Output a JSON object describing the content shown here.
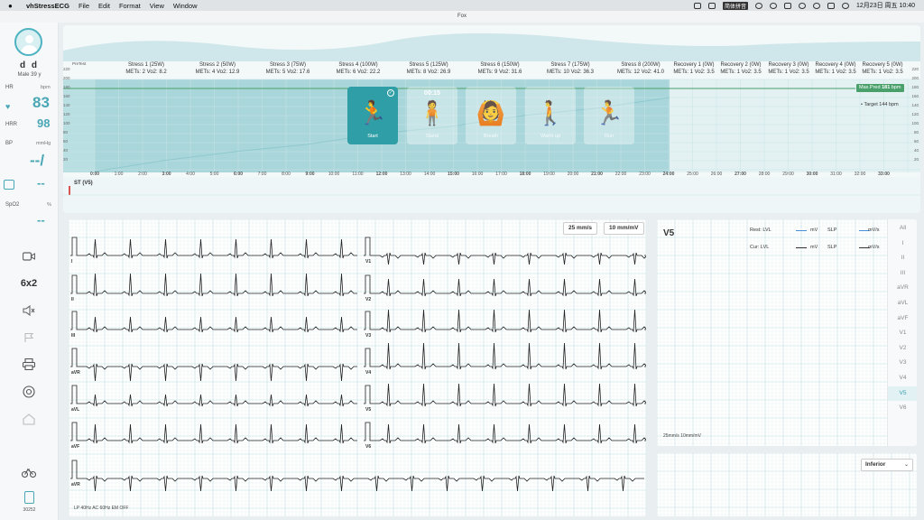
{
  "menubar": {
    "apple": "",
    "app": "vhStressECG",
    "menus": [
      "File",
      "Edit",
      "Format",
      "View",
      "Window"
    ],
    "ime": "简体拼音",
    "datetime": "12月23日 周五  10:40"
  },
  "window": {
    "title": "Fox"
  },
  "patient": {
    "name": "d d",
    "info": "Male 39 y"
  },
  "vitals": {
    "hr_label": "HR",
    "hr_unit": "bpm",
    "hr_value": "83",
    "hrr_label": "HRR",
    "hrr_value": "98",
    "bp_label": "BP",
    "bp_unit": "mmHg",
    "bp_value": "--/",
    "resp_value": "--",
    "spo2_label": "SpO2",
    "spo2_unit": "%",
    "spo2_value": "--"
  },
  "sidebar": {
    "layout_label": "6x2",
    "device_id": "30252",
    "icons": [
      "video-icon",
      "mute-icon",
      "flag-icon",
      "print-icon",
      "stop-icon",
      "home-icon",
      "bike-icon",
      "battery-icon"
    ]
  },
  "trend": {
    "pretest": "PreTest",
    "y_ticks": [
      "220",
      "200",
      "180",
      "160",
      "140",
      "120",
      "100",
      "80",
      "60",
      "40",
      "20"
    ],
    "stages": [
      {
        "name": "Stress 1 (25W)",
        "mets": "METs: 2  Vo2: 8.2"
      },
      {
        "name": "Stress 2 (50W)",
        "mets": "METs: 4  Vo2: 12.9"
      },
      {
        "name": "Stress 3 (75W)",
        "mets": "METs: 5  Vo2: 17.6"
      },
      {
        "name": "Stress 4 (100W)",
        "mets": "METs: 6  Vo2: 22.2"
      },
      {
        "name": "Stress 5 (125W)",
        "mets": "METs: 8  Vo2: 26.9"
      },
      {
        "name": "Stress 6 (150W)",
        "mets": "METs: 9  Vo2: 31.6"
      },
      {
        "name": "Stress 7 (175W)",
        "mets": "METs: 10  Vo2: 36.3"
      },
      {
        "name": "Stress 8 (200W)",
        "mets": "METs: 12  Vo2: 41.0"
      },
      {
        "name": "Recovery 1 (0W)",
        "mets": "METs: 1  Vo2: 3.5"
      },
      {
        "name": "Recovery 2 (0W)",
        "mets": "METs: 1  Vo2: 3.5"
      },
      {
        "name": "Recovery 3 (0W)",
        "mets": "METs: 1  Vo2: 3.5"
      },
      {
        "name": "Recovery 4 (0W)",
        "mets": "METs: 1  Vo2: 3.5"
      },
      {
        "name": "Recovery 5 (0W)",
        "mets": "METs: 1  Vo2: 3.5"
      }
    ],
    "time_ticks": [
      "0:00",
      "1:00",
      "2:00",
      "3:00",
      "4:00",
      "5:00",
      "6:00",
      "7:00",
      "8:00",
      "9:00",
      "10:00",
      "11:00",
      "12:00",
      "13:00",
      "14:00",
      "15:00",
      "16:00",
      "17:00",
      "18:00",
      "19:00",
      "20:00",
      "21:00",
      "22:00",
      "23:00",
      "24:00",
      "25:00",
      "26:00",
      "27:00",
      "28:00",
      "29:00",
      "30:00",
      "31:00",
      "32:00",
      "33:00"
    ],
    "max_pred_label": "Max.Pred",
    "max_pred_value": "181",
    "max_pred_unit": "bpm",
    "target_label": "Target",
    "target_value": "144",
    "target_unit": "bpm",
    "st_label": "ST (V5)",
    "activities": [
      {
        "label": "Start",
        "active": true
      },
      {
        "label": "Stand",
        "timer": "00:15",
        "active": false
      },
      {
        "label": "Breath",
        "active": false
      },
      {
        "label": "Warm up",
        "active": false
      },
      {
        "label": "Run",
        "active": false
      }
    ]
  },
  "ecg12": {
    "speed": "25 mm/s",
    "gain": "10 mm/mV",
    "leads_left": [
      "I",
      "II",
      "III",
      "aVR",
      "aVL",
      "aVF"
    ],
    "leads_right": [
      "V1",
      "V2",
      "V3",
      "V4",
      "V5",
      "V6"
    ],
    "rhythm_lead": "aVR",
    "filters": "LP 40Hz    AC 60Hz    EM OFF"
  },
  "v5panel": {
    "title": "V5",
    "rest_label": "Rest:  LVL",
    "cur_label": "Cur:  LVL",
    "mv": "mV",
    "slp": "SLP",
    "mvs": "mV/s",
    "scale": "25mm/s  10mm/mV",
    "leads": [
      "All",
      "I",
      "II",
      "III",
      "aVR",
      "aVL",
      "aVF",
      "V1",
      "V2",
      "V3",
      "V4",
      "V5",
      "V6"
    ],
    "selected": "V5"
  },
  "inferior": {
    "select_value": "Inferior"
  },
  "colors": {
    "accent": "#4aa7b5",
    "maxpred": "#4aa06b",
    "active_card": "#2f9ea6",
    "grid": "#d9ecee"
  }
}
